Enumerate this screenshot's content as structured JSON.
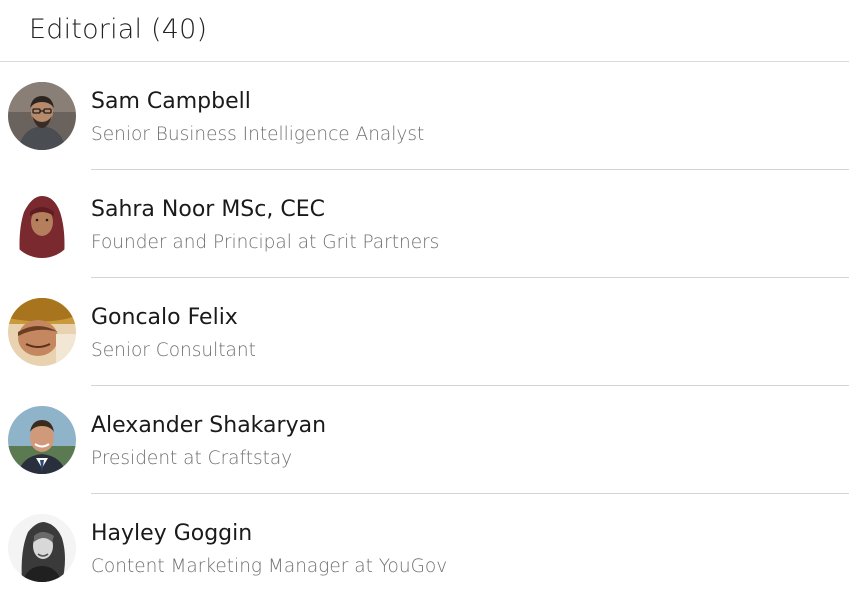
{
  "section": {
    "title": "Editorial (40)"
  },
  "people": [
    {
      "name": "Sam Campbell",
      "title": "Senior Business Intelligence Analyst",
      "avatar_icon": "profile-photo-man-glasses"
    },
    {
      "name": "Sahra Noor MSc, CEC",
      "title": "Founder and Principal at Grit Partners",
      "avatar_icon": "profile-photo-woman-hijab"
    },
    {
      "name": "Goncalo Felix",
      "title": "Senior Consultant",
      "avatar_icon": "profile-photo-man-warm-tones"
    },
    {
      "name": "Alexander Shakaryan",
      "title": "President at Craftstay",
      "avatar_icon": "profile-photo-man-suit"
    },
    {
      "name": "Hayley Goggin",
      "title": "Content Marketing Manager at YouGov",
      "avatar_icon": "profile-photo-woman-grayscale"
    }
  ],
  "colors": {
    "text_primary": "#1a1a1a",
    "text_secondary": "#707070",
    "divider": "#d4d4d4"
  }
}
